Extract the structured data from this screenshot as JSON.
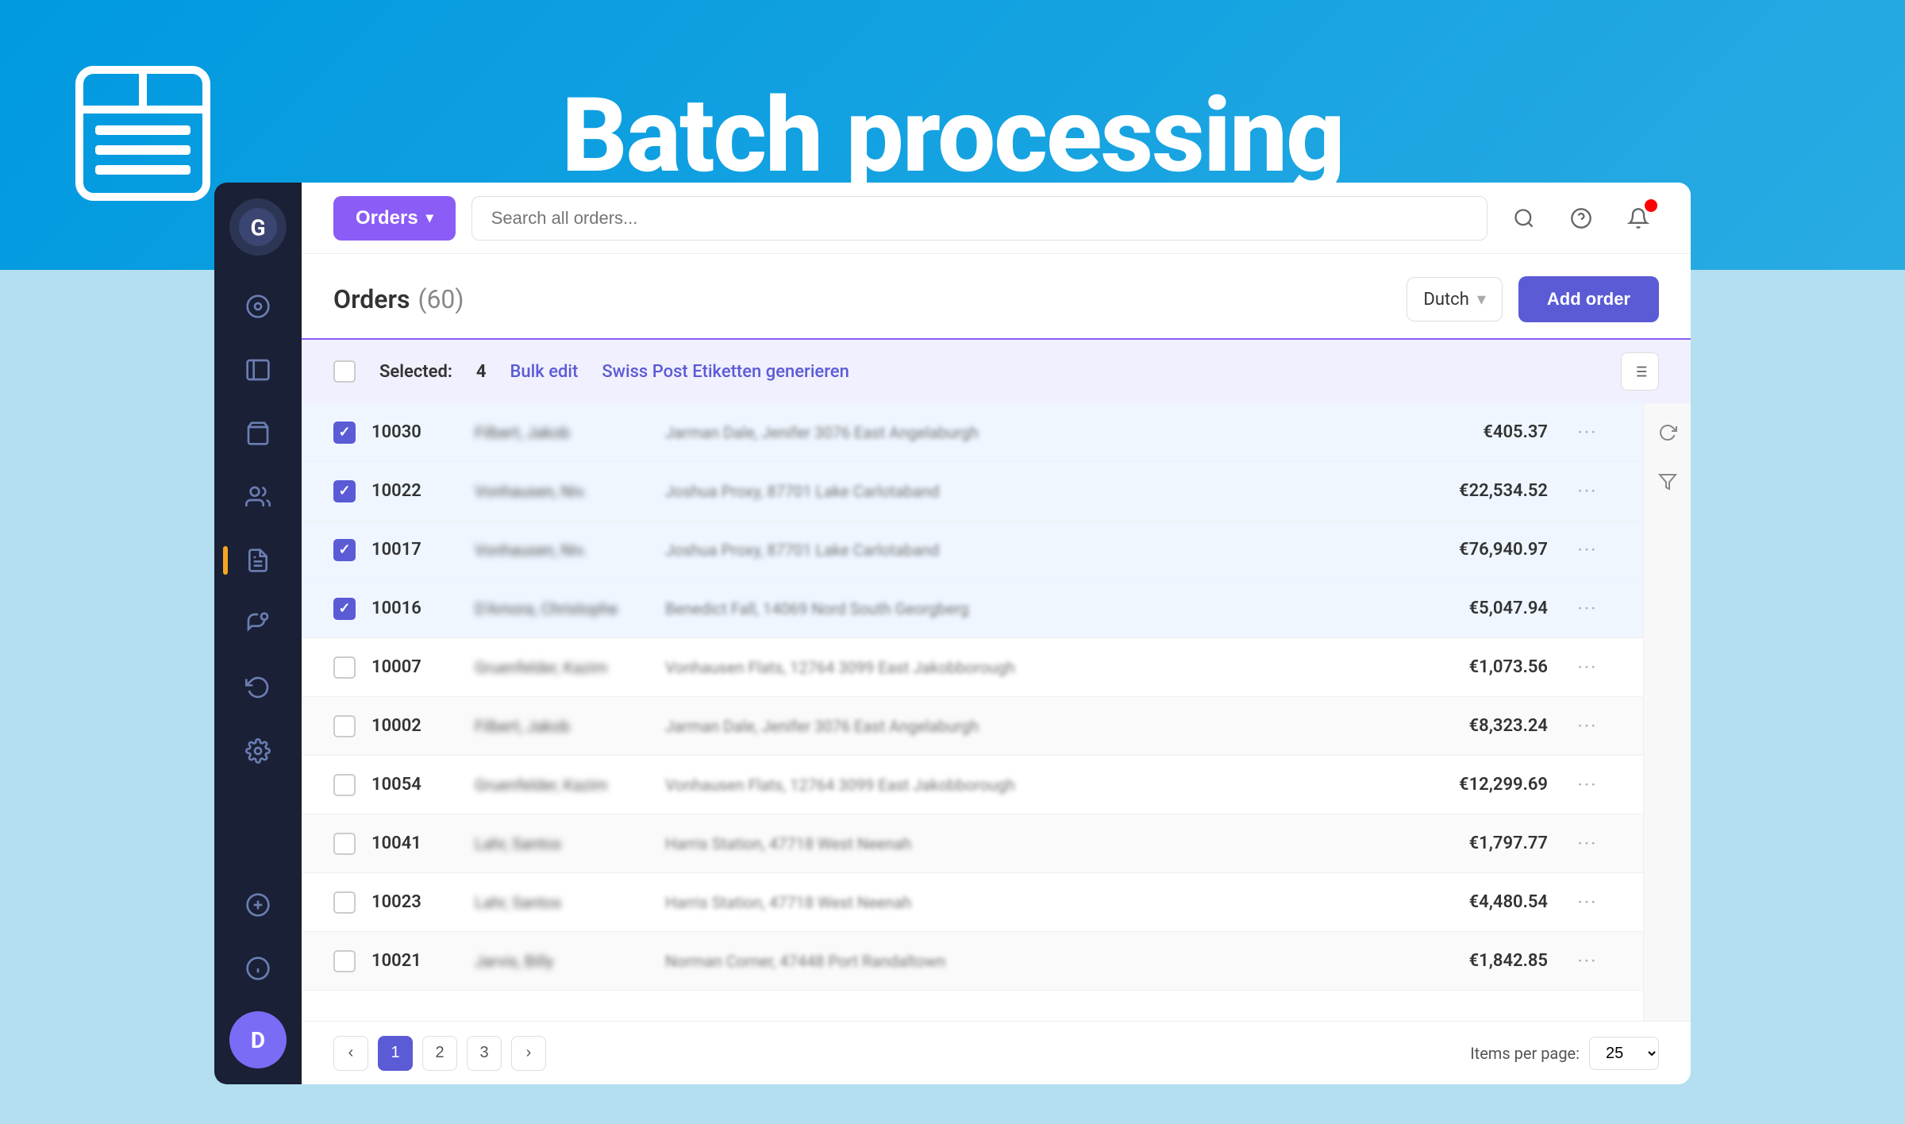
{
  "banner": {
    "title": "Batch processing"
  },
  "sidebar": {
    "logo_letter": "G",
    "avatar_letter": "D",
    "items": [
      {
        "name": "dashboard",
        "icon": "⊙"
      },
      {
        "name": "packages",
        "icon": "⊞"
      },
      {
        "name": "shopping-bag",
        "icon": "🛍"
      },
      {
        "name": "users",
        "icon": "👥"
      },
      {
        "name": "reports",
        "icon": "📋"
      },
      {
        "name": "megaphone",
        "icon": "📣"
      },
      {
        "name": "returns",
        "icon": "↩"
      },
      {
        "name": "settings",
        "icon": "⚙"
      },
      {
        "name": "add-circle",
        "icon": "⊕"
      },
      {
        "name": "info",
        "icon": "ⓘ"
      }
    ]
  },
  "topbar": {
    "orders_btn": "Orders",
    "search_placeholder": "Search all orders...",
    "help_icon": "?",
    "notification_icon": "🔔"
  },
  "orders_section": {
    "title": "Orders",
    "count": "(60)",
    "language": "Dutch",
    "add_order_btn": "Add order"
  },
  "bulk_bar": {
    "selected_label": "Selected:",
    "selected_count": "4",
    "bulk_edit_label": "Bulk edit",
    "action_label": "Swiss Post Etiketten generieren"
  },
  "table": {
    "rows": [
      {
        "id": "10030",
        "name": "Filbert, Jakob",
        "address": "Jarman Dale, Jenifer 3076 East Angelaburgh",
        "amount": "€405.37",
        "selected": true
      },
      {
        "id": "10022",
        "name": "Vonhausen, Niv.",
        "address": "Joshua Proxy, 87701 Lake Carlotaband",
        "amount": "€22,534.52",
        "selected": true
      },
      {
        "id": "10017",
        "name": "Vonhausen, Niv.",
        "address": "Joshua Proxy, 87701 Lake Carlotaband",
        "amount": "€76,940.97",
        "selected": true
      },
      {
        "id": "10016",
        "name": "D'Amora, Christophe",
        "address": "Benedict Fall, 14069 Nord South Georgberg",
        "amount": "€5,047.94",
        "selected": true
      },
      {
        "id": "10007",
        "name": "Gruenfelder, Kazim",
        "address": "Vonhausen Flats, 12764 3099 East Jakobborough",
        "amount": "€1,073.56",
        "selected": false
      },
      {
        "id": "10002",
        "name": "Filbert, Jakob",
        "address": "Jarman Dale, Jenifer 3076 East Angelaburgh",
        "amount": "€8,323.24",
        "selected": false
      },
      {
        "id": "10054",
        "name": "Gruenfelder, Kazim",
        "address": "Vonhausen Flats, 12764 3099 East Jakobborough",
        "amount": "€12,299.69",
        "selected": false
      },
      {
        "id": "10041",
        "name": "Lahr, Santos",
        "address": "Harris Station, 47718 West Neenah",
        "amount": "€1,797.77",
        "selected": false
      },
      {
        "id": "10023",
        "name": "Lahr, Santos",
        "address": "Harris Station, 47718 West Neenah",
        "amount": "€4,480.54",
        "selected": false
      },
      {
        "id": "10021",
        "name": "Jarvis, Billy",
        "address": "Norman Corner, 47448 Port Randaltown",
        "amount": "€1,842.85",
        "selected": false
      }
    ]
  },
  "pagination": {
    "prev_icon": "‹",
    "next_icon": "›",
    "pages": [
      "1",
      "2",
      "3"
    ],
    "active_page": "1",
    "items_per_page_label": "Items per page:",
    "items_per_page_value": "25"
  }
}
